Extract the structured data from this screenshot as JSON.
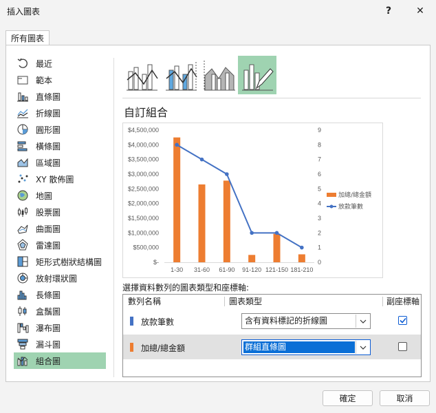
{
  "window": {
    "title": "插入圖表",
    "help": "?",
    "close": "✕"
  },
  "tabs": [
    {
      "label": "所有圖表"
    }
  ],
  "sidebar": {
    "items": [
      {
        "label": "最近",
        "icon": "recent-icon"
      },
      {
        "label": "範本",
        "icon": "template-icon"
      },
      {
        "label": "直條圖",
        "icon": "column-chart-icon"
      },
      {
        "label": "折線圖",
        "icon": "line-chart-icon"
      },
      {
        "label": "圓形圖",
        "icon": "pie-chart-icon"
      },
      {
        "label": "橫條圖",
        "icon": "bar-chart-icon"
      },
      {
        "label": "區域圖",
        "icon": "area-chart-icon"
      },
      {
        "label": "XY 散佈圖",
        "icon": "scatter-chart-icon"
      },
      {
        "label": "地圖",
        "icon": "map-chart-icon"
      },
      {
        "label": "股票圖",
        "icon": "stock-chart-icon"
      },
      {
        "label": "曲面圖",
        "icon": "surface-chart-icon"
      },
      {
        "label": "雷達圖",
        "icon": "radar-chart-icon"
      },
      {
        "label": "矩形式樹狀結構圖",
        "icon": "treemap-icon"
      },
      {
        "label": "放射環狀圖",
        "icon": "sunburst-icon"
      },
      {
        "label": "長條圖",
        "icon": "histogram-icon"
      },
      {
        "label": "盒鬚圖",
        "icon": "box-whisker-icon"
      },
      {
        "label": "瀑布圖",
        "icon": "waterfall-icon"
      },
      {
        "label": "漏斗圖",
        "icon": "funnel-icon"
      },
      {
        "label": "組合圖",
        "icon": "combo-chart-icon",
        "selected": true
      }
    ]
  },
  "subtypes": [
    {
      "name": "clustered-column-line",
      "selected": false
    },
    {
      "name": "clustered-column-line-secondary-axis",
      "selected": false
    },
    {
      "name": "stacked-area-clustered-column",
      "selected": false
    },
    {
      "name": "custom-combination",
      "selected": true
    }
  ],
  "section_title": "自訂組合",
  "chart_data": {
    "type": "bar",
    "categories": [
      "1-30",
      "31-60",
      "61-90",
      "91-120",
      "121-150",
      "181-210"
    ],
    "series": [
      {
        "name": "加總/總金額",
        "type": "bar",
        "axis": "primary",
        "color": "#ed7d31",
        "values": [
          4250000,
          2650000,
          2780000,
          250000,
          970000,
          270000
        ]
      },
      {
        "name": "放款筆數",
        "type": "line",
        "axis": "secondary",
        "color": "#4472c4",
        "values": [
          8,
          7,
          6,
          2,
          2,
          1
        ]
      }
    ],
    "y_ticks": [
      "$-",
      "$500,000",
      "$1,000,000",
      "$1,500,000",
      "$2,000,000",
      "$2,500,000",
      "$3,000,000",
      "$3,500,000",
      "$4,000,000",
      "$4,500,000"
    ],
    "y2_ticks": [
      "0",
      "1",
      "2",
      "3",
      "4",
      "5",
      "6",
      "7",
      "8",
      "9"
    ],
    "ylim": [
      0,
      4500000
    ],
    "y2lim": [
      0,
      9
    ],
    "legend": "right",
    "grid": false
  },
  "series_panel": {
    "heading": "選擇資料數列的圖表類型和座標軸:",
    "columns": [
      "數列名稱",
      "圖表類型",
      "副座標軸"
    ],
    "rows": [
      {
        "name": "放款筆數",
        "color": "#4472c4",
        "chart_type": "含有資料標記的折線圖",
        "secondary_axis": true,
        "selected": false
      },
      {
        "name": "加總/總金額",
        "color": "#ed7d31",
        "chart_type": "群組直條圖",
        "secondary_axis": false,
        "selected": true
      }
    ]
  },
  "footer": {
    "ok_label": "確定",
    "cancel_label": "取消"
  }
}
